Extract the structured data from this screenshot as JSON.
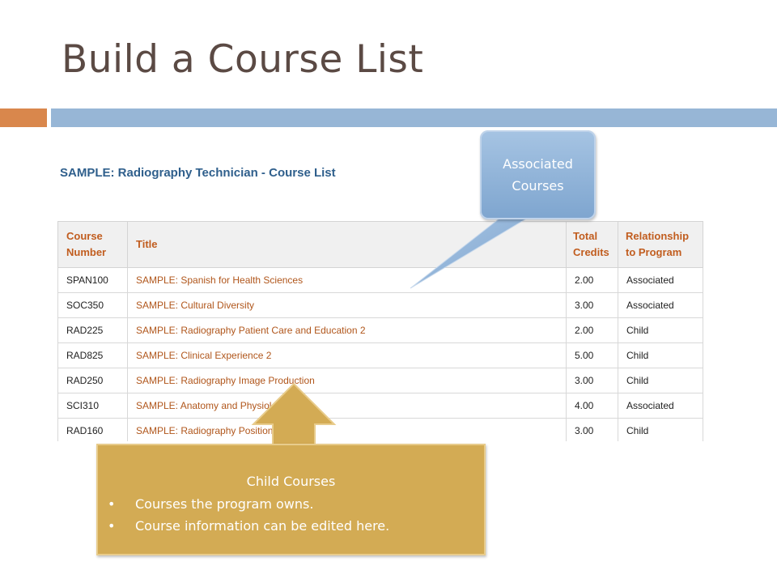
{
  "slide": {
    "title": "Build a Course List"
  },
  "course_list": {
    "program": "SAMPLE: Radiography Technician",
    "separator": " - ",
    "suffix": "Course List",
    "headers": {
      "number_line1": "Course",
      "number_line2": "Number",
      "title": "Title",
      "credits_line1": "Total",
      "credits_line2": "Credits",
      "relationship_line1": "Relationship",
      "relationship_line2": "to Program"
    },
    "rows": [
      {
        "number": "SPAN100",
        "title": "SAMPLE: Spanish for Health Sciences",
        "credits": "2.00",
        "relationship": "Associated"
      },
      {
        "number": "SOC350",
        "title": "SAMPLE: Cultural Diversity",
        "credits": "3.00",
        "relationship": "Associated"
      },
      {
        "number": "RAD225",
        "title": "SAMPLE: Radiography Patient Care and Education 2",
        "credits": "2.00",
        "relationship": "Child"
      },
      {
        "number": "RAD825",
        "title": "SAMPLE: Clinical Experience 2",
        "credits": "5.00",
        "relationship": "Child"
      },
      {
        "number": "RAD250",
        "title": "SAMPLE: Radiography Image Production",
        "credits": "3.00",
        "relationship": "Child"
      },
      {
        "number": "SCI310",
        "title": "SAMPLE: Anatomy and Physiology 2",
        "credits": "4.00",
        "relationship": "Associated"
      },
      {
        "number": "RAD160",
        "title": "SAMPLE: Radiography Positioning 2",
        "credits": "3.00",
        "relationship": "Child"
      }
    ]
  },
  "callouts": {
    "associated": {
      "line1": "Associated",
      "line2": "Courses"
    },
    "child": {
      "heading": "Child Courses",
      "bullet": "•",
      "points": [
        "Courses the program owns.",
        "Course information can be edited here."
      ]
    }
  },
  "colors": {
    "title_text": "#5b4a44",
    "accent_orange": "#d9874c",
    "accent_blue": "#97b6d6",
    "course_title_link": "#b0561b",
    "header_text": "#c15d1f",
    "list_title": "#2f5f8c",
    "callout_blue": "#8fb1d8",
    "callout_gold": "#d3ab54"
  }
}
